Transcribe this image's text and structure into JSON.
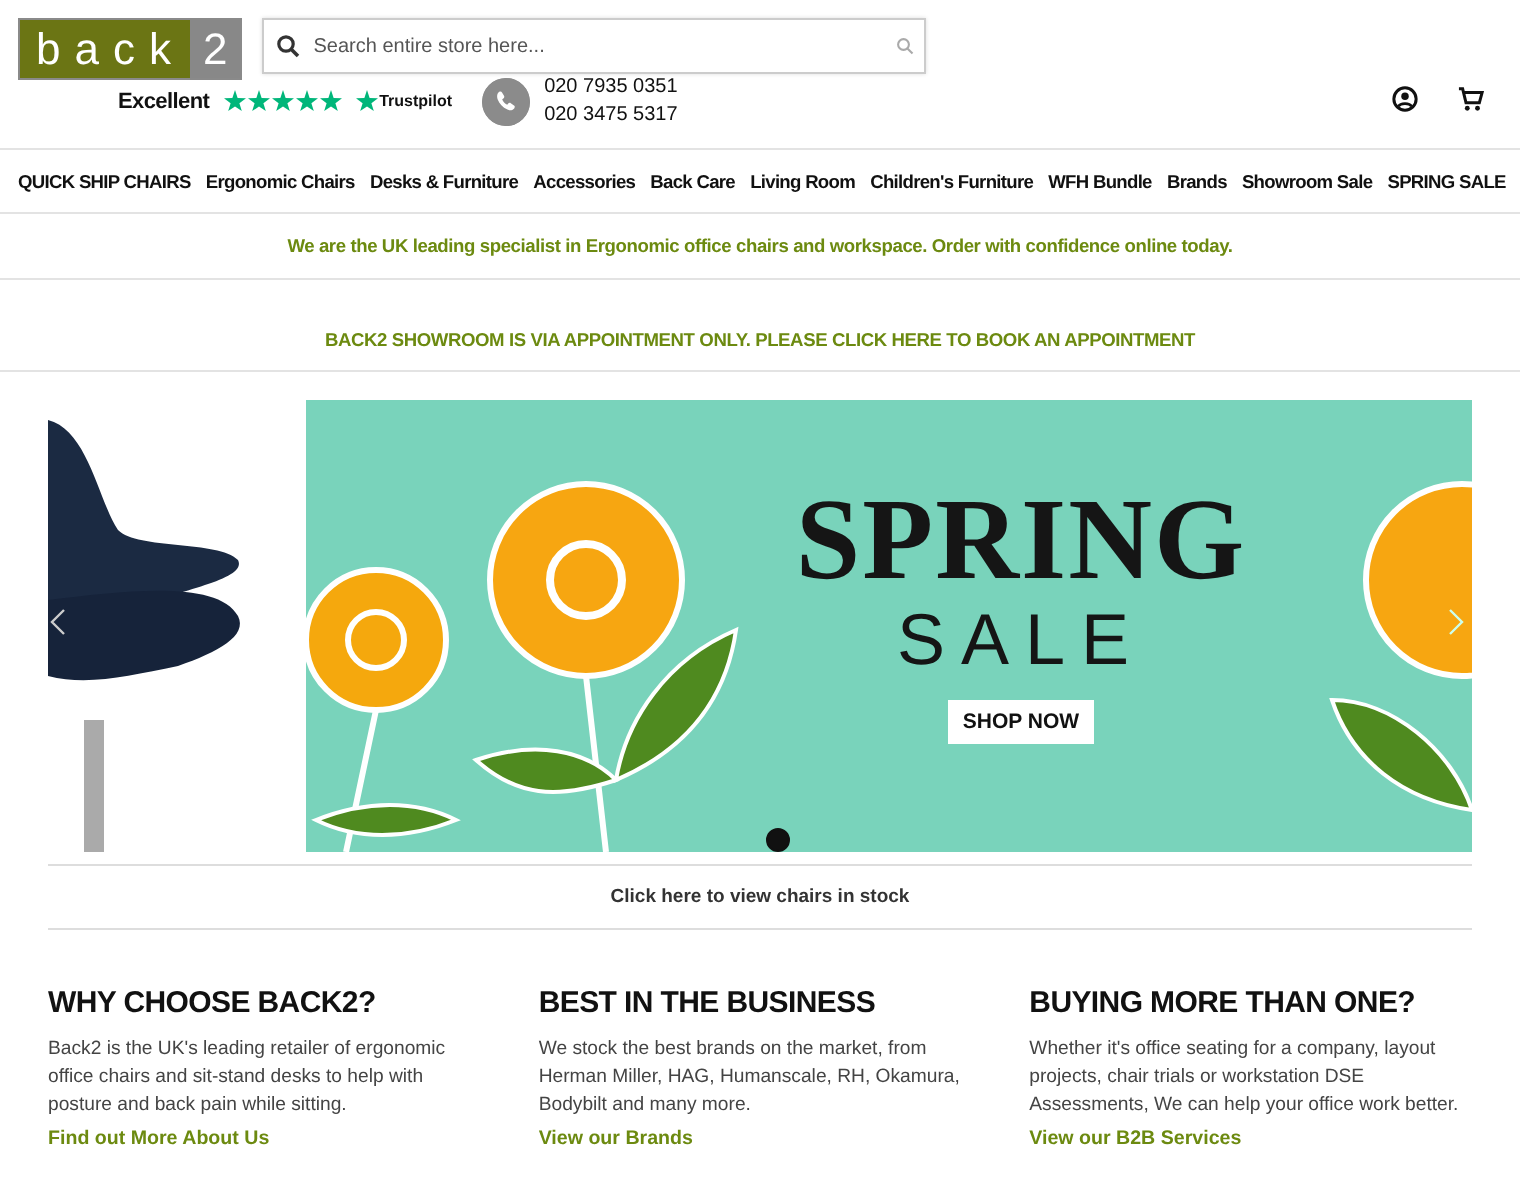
{
  "header": {
    "logo": {
      "word": "back",
      "digit": "2"
    },
    "search": {
      "placeholder": "Search entire store here..."
    },
    "rating": {
      "label": "Excellent",
      "stars": 5,
      "brand": "Trustpilot"
    },
    "phones": [
      "020 7935 0351",
      "020 3475 5317"
    ]
  },
  "nav": {
    "items": [
      {
        "label": "QUICK SHIP CHAIRS"
      },
      {
        "label": "Ergonomic Chairs"
      },
      {
        "label": "Desks & Furniture"
      },
      {
        "label": "Accessories"
      },
      {
        "label": "Back Care"
      },
      {
        "label": "Living Room"
      },
      {
        "label": "Children's Furniture"
      },
      {
        "label": "WFH Bundle"
      },
      {
        "label": "Brands"
      },
      {
        "label": "Showroom Sale"
      },
      {
        "label": "SPRING SALE"
      }
    ]
  },
  "notices": [
    "We are the UK leading specialist in Ergonomic office chairs and workspace. Order with confidence online today.",
    "BACK2 SHOWROOM IS VIA APPOINTMENT ONLY. PLEASE CLICK HERE TO BOOK AN APPOINTMENT"
  ],
  "banner": {
    "title": "SPRING",
    "subtitle": "SALE",
    "button": "SHOP NOW",
    "dots": [
      {
        "selected": true
      }
    ]
  },
  "stock_link": "Click here to view chairs in stock",
  "columns": [
    {
      "heading": "WHY CHOOSE BACK2?",
      "text": "Back2 is the UK's leading retailer of ergonomic office chairs and sit-stand desks to help with posture and back pain while sitting.",
      "link": "Find out More About Us"
    },
    {
      "heading": "BEST IN THE BUSINESS",
      "text": "We stock the best brands on the market, from Herman Miller, HAG, Humanscale, RH, Okamura, Bodybilt and many more.",
      "link": "View our Brands"
    },
    {
      "heading": "BUYING MORE THAN ONE?",
      "text": "Whether it's office seating for a company, layout projects, chair trials or workstation DSE Assessments, We can help your office work better.",
      "link": "View our B2B Services"
    }
  ]
}
